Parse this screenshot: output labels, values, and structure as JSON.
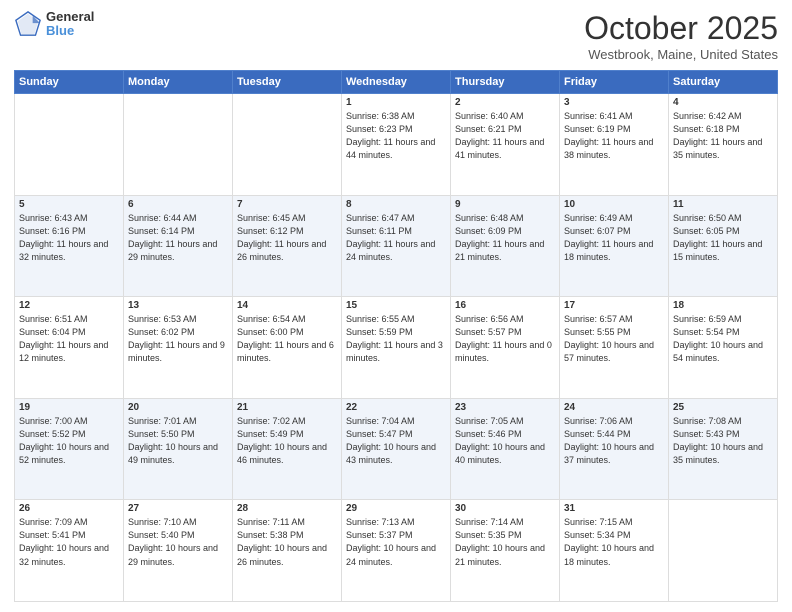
{
  "header": {
    "logo_line1": "General",
    "logo_line2": "Blue",
    "month_title": "October 2025",
    "location": "Westbrook, Maine, United States"
  },
  "days_of_week": [
    "Sunday",
    "Monday",
    "Tuesday",
    "Wednesday",
    "Thursday",
    "Friday",
    "Saturday"
  ],
  "weeks": [
    [
      {
        "day": "",
        "info": ""
      },
      {
        "day": "",
        "info": ""
      },
      {
        "day": "",
        "info": ""
      },
      {
        "day": "1",
        "info": "Sunrise: 6:38 AM\nSunset: 6:23 PM\nDaylight: 11 hours and 44 minutes."
      },
      {
        "day": "2",
        "info": "Sunrise: 6:40 AM\nSunset: 6:21 PM\nDaylight: 11 hours and 41 minutes."
      },
      {
        "day": "3",
        "info": "Sunrise: 6:41 AM\nSunset: 6:19 PM\nDaylight: 11 hours and 38 minutes."
      },
      {
        "day": "4",
        "info": "Sunrise: 6:42 AM\nSunset: 6:18 PM\nDaylight: 11 hours and 35 minutes."
      }
    ],
    [
      {
        "day": "5",
        "info": "Sunrise: 6:43 AM\nSunset: 6:16 PM\nDaylight: 11 hours and 32 minutes."
      },
      {
        "day": "6",
        "info": "Sunrise: 6:44 AM\nSunset: 6:14 PM\nDaylight: 11 hours and 29 minutes."
      },
      {
        "day": "7",
        "info": "Sunrise: 6:45 AM\nSunset: 6:12 PM\nDaylight: 11 hours and 26 minutes."
      },
      {
        "day": "8",
        "info": "Sunrise: 6:47 AM\nSunset: 6:11 PM\nDaylight: 11 hours and 24 minutes."
      },
      {
        "day": "9",
        "info": "Sunrise: 6:48 AM\nSunset: 6:09 PM\nDaylight: 11 hours and 21 minutes."
      },
      {
        "day": "10",
        "info": "Sunrise: 6:49 AM\nSunset: 6:07 PM\nDaylight: 11 hours and 18 minutes."
      },
      {
        "day": "11",
        "info": "Sunrise: 6:50 AM\nSunset: 6:05 PM\nDaylight: 11 hours and 15 minutes."
      }
    ],
    [
      {
        "day": "12",
        "info": "Sunrise: 6:51 AM\nSunset: 6:04 PM\nDaylight: 11 hours and 12 minutes."
      },
      {
        "day": "13",
        "info": "Sunrise: 6:53 AM\nSunset: 6:02 PM\nDaylight: 11 hours and 9 minutes."
      },
      {
        "day": "14",
        "info": "Sunrise: 6:54 AM\nSunset: 6:00 PM\nDaylight: 11 hours and 6 minutes."
      },
      {
        "day": "15",
        "info": "Sunrise: 6:55 AM\nSunset: 5:59 PM\nDaylight: 11 hours and 3 minutes."
      },
      {
        "day": "16",
        "info": "Sunrise: 6:56 AM\nSunset: 5:57 PM\nDaylight: 11 hours and 0 minutes."
      },
      {
        "day": "17",
        "info": "Sunrise: 6:57 AM\nSunset: 5:55 PM\nDaylight: 10 hours and 57 minutes."
      },
      {
        "day": "18",
        "info": "Sunrise: 6:59 AM\nSunset: 5:54 PM\nDaylight: 10 hours and 54 minutes."
      }
    ],
    [
      {
        "day": "19",
        "info": "Sunrise: 7:00 AM\nSunset: 5:52 PM\nDaylight: 10 hours and 52 minutes."
      },
      {
        "day": "20",
        "info": "Sunrise: 7:01 AM\nSunset: 5:50 PM\nDaylight: 10 hours and 49 minutes."
      },
      {
        "day": "21",
        "info": "Sunrise: 7:02 AM\nSunset: 5:49 PM\nDaylight: 10 hours and 46 minutes."
      },
      {
        "day": "22",
        "info": "Sunrise: 7:04 AM\nSunset: 5:47 PM\nDaylight: 10 hours and 43 minutes."
      },
      {
        "day": "23",
        "info": "Sunrise: 7:05 AM\nSunset: 5:46 PM\nDaylight: 10 hours and 40 minutes."
      },
      {
        "day": "24",
        "info": "Sunrise: 7:06 AM\nSunset: 5:44 PM\nDaylight: 10 hours and 37 minutes."
      },
      {
        "day": "25",
        "info": "Sunrise: 7:08 AM\nSunset: 5:43 PM\nDaylight: 10 hours and 35 minutes."
      }
    ],
    [
      {
        "day": "26",
        "info": "Sunrise: 7:09 AM\nSunset: 5:41 PM\nDaylight: 10 hours and 32 minutes."
      },
      {
        "day": "27",
        "info": "Sunrise: 7:10 AM\nSunset: 5:40 PM\nDaylight: 10 hours and 29 minutes."
      },
      {
        "day": "28",
        "info": "Sunrise: 7:11 AM\nSunset: 5:38 PM\nDaylight: 10 hours and 26 minutes."
      },
      {
        "day": "29",
        "info": "Sunrise: 7:13 AM\nSunset: 5:37 PM\nDaylight: 10 hours and 24 minutes."
      },
      {
        "day": "30",
        "info": "Sunrise: 7:14 AM\nSunset: 5:35 PM\nDaylight: 10 hours and 21 minutes."
      },
      {
        "day": "31",
        "info": "Sunrise: 7:15 AM\nSunset: 5:34 PM\nDaylight: 10 hours and 18 minutes."
      },
      {
        "day": "",
        "info": ""
      }
    ]
  ]
}
